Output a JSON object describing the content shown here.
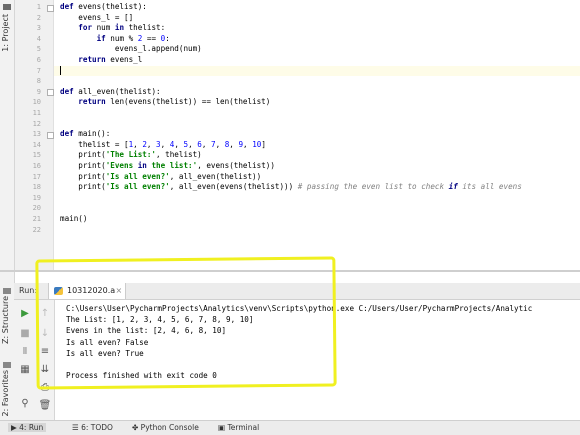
{
  "side_tabs": {
    "project": "1: Project",
    "structure": "Z: Structure",
    "favorites": "2: Favorites"
  },
  "editor": {
    "line_numbers": [
      "1",
      "2",
      "3",
      "4",
      "5",
      "6",
      "7",
      "8",
      "9",
      "10",
      "11",
      "12",
      "13",
      "14",
      "15",
      "16",
      "17",
      "18",
      "19",
      "20",
      "21",
      "22"
    ],
    "lines": [
      {
        "kind": "def",
        "text": "def evens(thelist):"
      },
      {
        "kind": "plain",
        "text": "    evens_l = []"
      },
      {
        "kind": "for",
        "text": "    for num in thelist:"
      },
      {
        "kind": "if",
        "text": "        if num % 2 == 0:"
      },
      {
        "kind": "plain",
        "text": "            evens_l.append(num)"
      },
      {
        "kind": "ret",
        "text": "    return evens_l"
      },
      {
        "kind": "caret",
        "text": ""
      },
      {
        "kind": "blank",
        "text": ""
      },
      {
        "kind": "def",
        "text": "def all_even(thelist):"
      },
      {
        "kind": "ret",
        "text": "    return len(evens(thelist)) == len(thelist)"
      },
      {
        "kind": "blank",
        "text": ""
      },
      {
        "kind": "blank",
        "text": ""
      },
      {
        "kind": "def",
        "text": "def main():"
      },
      {
        "kind": "plain",
        "text": "    thelist = [1, 2, 3, 4, 5, 6, 7, 8, 9, 10]"
      },
      {
        "kind": "print",
        "text": "    print('The List:', thelist)"
      },
      {
        "kind": "print",
        "text": "    print('Evens in the list:', evens(thelist))"
      },
      {
        "kind": "print",
        "text": "    print('Is all even?', all_even(thelist))"
      },
      {
        "kind": "print",
        "text": "    print('Is all even?', all_even(evens(thelist))) # passing the even list to check if its all evens"
      },
      {
        "kind": "blank",
        "text": ""
      },
      {
        "kind": "blank",
        "text": ""
      },
      {
        "kind": "plain",
        "text": "main()"
      },
      {
        "kind": "blank",
        "text": ""
      }
    ]
  },
  "run_panel": {
    "label": "Run:",
    "tab_name": "10312020.a",
    "close": "×"
  },
  "console": {
    "lines": [
      "C:\\Users\\User\\PycharmProjects\\Analytics\\venv\\Scripts\\python.exe C:/Users/User/PycharmProjects/Analytic",
      "The List: [1, 2, 3, 4, 5, 6, 7, 8, 9, 10]",
      "Evens in the list: [2, 4, 6, 8, 10]",
      "Is all even? False",
      "Is all even? True",
      "",
      "Process finished with exit code 0"
    ]
  },
  "bottom_bar": {
    "run": "4: Run",
    "todo": "6: TODO",
    "python_console": "Python Console",
    "terminal": "Terminal"
  },
  "colors": {
    "highlight": "#f0f020",
    "keyword": "#000080",
    "number": "#0000ff",
    "string": "#008000",
    "comment": "#808080"
  }
}
